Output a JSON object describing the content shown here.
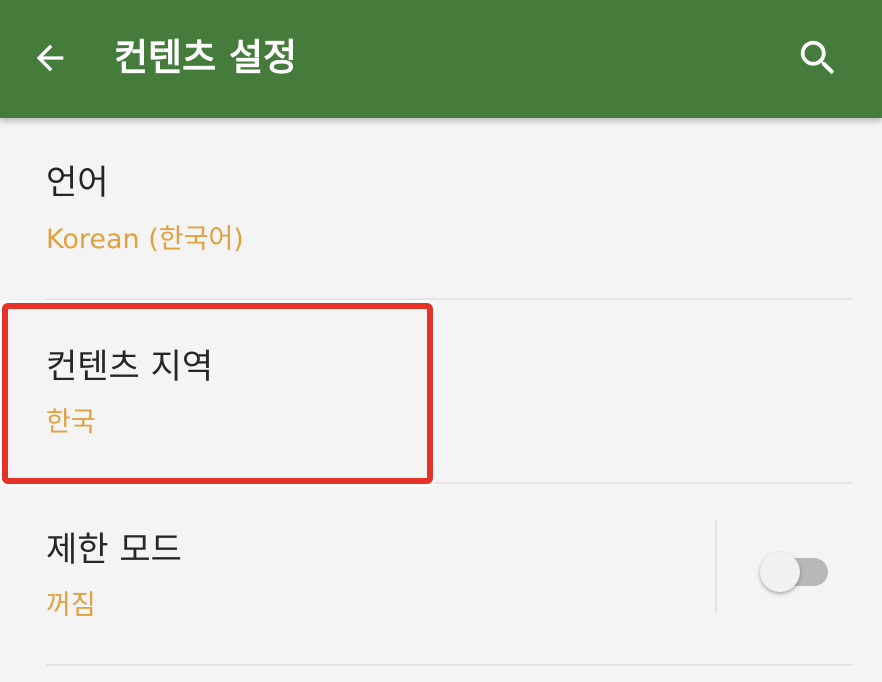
{
  "app_bar": {
    "title": "컨텐츠 설정",
    "back_icon": "arrow-left-icon",
    "search_icon": "search-icon",
    "background_color": "#457b3b"
  },
  "settings": {
    "language": {
      "title": "언어",
      "summary": "Korean (한국어)"
    },
    "content_region": {
      "title": "컨텐츠 지역",
      "summary": "한국",
      "highlighted": true,
      "highlight_color": "#e53327"
    },
    "restricted_mode": {
      "title": "제한 모드",
      "summary": "꺼짐",
      "toggle_on": false
    }
  },
  "colors": {
    "summary_text": "#e2a03f",
    "title_text": "#262626",
    "background": "#f4f4f4"
  }
}
